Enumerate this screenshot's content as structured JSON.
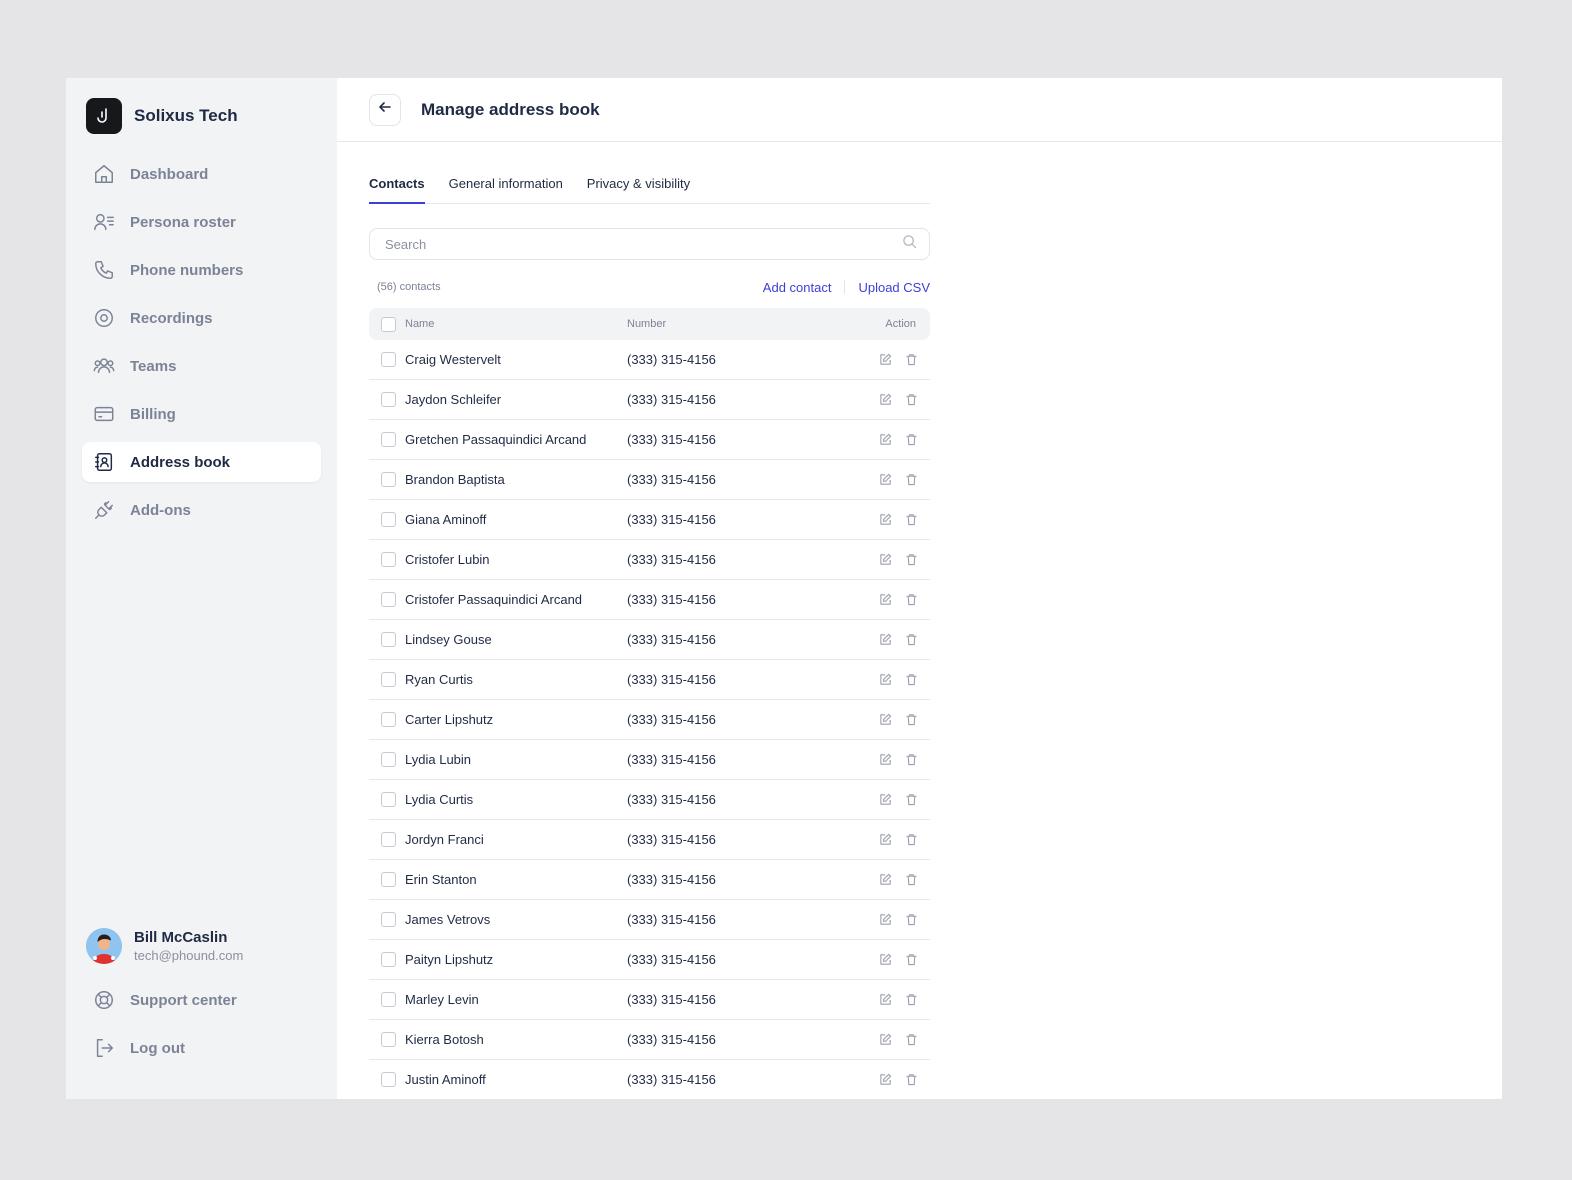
{
  "brand": {
    "name": "Solixus Tech",
    "logo_letter": "J"
  },
  "sidebar": {
    "items": [
      {
        "label": "Dashboard",
        "icon": "home-icon",
        "active": false
      },
      {
        "label": "Persona roster",
        "icon": "users-list-icon",
        "active": false
      },
      {
        "label": "Phone numbers",
        "icon": "phone-icon",
        "active": false
      },
      {
        "label": "Recordings",
        "icon": "record-icon",
        "active": false
      },
      {
        "label": "Teams",
        "icon": "team-icon",
        "active": false
      },
      {
        "label": "Billing",
        "icon": "credit-card-icon",
        "active": false
      },
      {
        "label": "Address book",
        "icon": "address-book-icon",
        "active": true
      },
      {
        "label": "Add-ons",
        "icon": "plug-icon",
        "active": false
      }
    ],
    "user": {
      "name": "Bill McCaslin",
      "email": "tech@phound.com"
    },
    "bottom": [
      {
        "label": "Support center",
        "icon": "lifebuoy-icon"
      },
      {
        "label": "Log out",
        "icon": "logout-icon"
      }
    ]
  },
  "header": {
    "title": "Manage address book"
  },
  "tabs": [
    {
      "label": "Contacts",
      "active": true
    },
    {
      "label": "General information",
      "active": false
    },
    {
      "label": "Privacy & visibility",
      "active": false
    }
  ],
  "search": {
    "placeholder": "Search"
  },
  "toolbar": {
    "count": "(56) contacts",
    "add_contact": "Add contact",
    "upload_csv": "Upload CSV"
  },
  "table": {
    "columns": {
      "name": "Name",
      "number": "Number",
      "action": "Action"
    },
    "rows": [
      {
        "name": "Craig Westervelt",
        "number": "(333) 315-4156"
      },
      {
        "name": "Jaydon Schleifer",
        "number": "(333) 315-4156"
      },
      {
        "name": "Gretchen Passaquindici Arcand",
        "number": "(333) 315-4156"
      },
      {
        "name": "Brandon Baptista",
        "number": "(333) 315-4156"
      },
      {
        "name": "Giana Aminoff",
        "number": "(333) 315-4156"
      },
      {
        "name": "Cristofer Lubin",
        "number": "(333) 315-4156"
      },
      {
        "name": "Cristofer Passaquindici Arcand",
        "number": "(333) 315-4156"
      },
      {
        "name": "Lindsey Gouse",
        "number": "(333) 315-4156"
      },
      {
        "name": "Ryan Curtis",
        "number": "(333) 315-4156"
      },
      {
        "name": "Carter Lipshutz",
        "number": "(333) 315-4156"
      },
      {
        "name": "Lydia Lubin",
        "number": "(333) 315-4156"
      },
      {
        "name": "Lydia Curtis",
        "number": "(333) 315-4156"
      },
      {
        "name": "Jordyn Franci",
        "number": "(333) 315-4156"
      },
      {
        "name": "Erin Stanton",
        "number": "(333) 315-4156"
      },
      {
        "name": "James Vetrovs",
        "number": "(333) 315-4156"
      },
      {
        "name": "Paityn Lipshutz",
        "number": "(333) 315-4156"
      },
      {
        "name": "Marley Levin",
        "number": "(333) 315-4156"
      },
      {
        "name": "Kierra Botosh",
        "number": "(333) 315-4156"
      },
      {
        "name": "Justin Aminoff",
        "number": "(333) 315-4156"
      }
    ]
  },
  "colors": {
    "accent": "#3b3fd8",
    "sidebar_bg": "#f2f3f5",
    "text": "#1f2a44",
    "muted": "#7c8396"
  }
}
